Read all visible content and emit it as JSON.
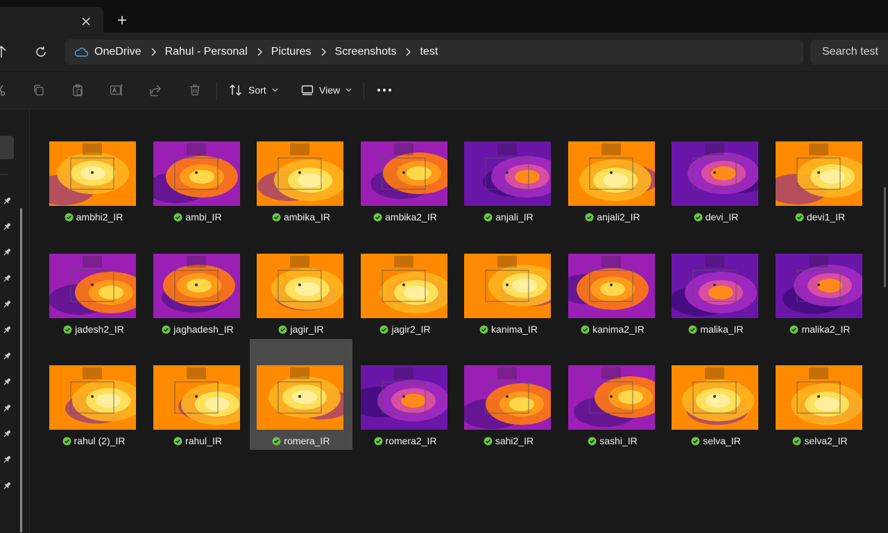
{
  "tab": {
    "close_glyph": "✕",
    "new_tab_glyph": "+"
  },
  "breadcrumb": [
    "OneDrive",
    "Rahul - Personal",
    "Pictures",
    "Screenshots",
    "test"
  ],
  "search": {
    "placeholder": "Search test"
  },
  "commands": {
    "sort_label": "Sort",
    "view_label": "View"
  },
  "colors": {
    "accent_sync": "#6cc24a",
    "thermal_hot": "#fff4a8",
    "thermal_warm": "#ff9a1a",
    "thermal_cool": "#7a1fa8"
  },
  "files": [
    {
      "name": "ambhi2_IR",
      "palette": "warm"
    },
    {
      "name": "ambi_IR",
      "palette": "mixed"
    },
    {
      "name": "ambika_IR",
      "palette": "warm"
    },
    {
      "name": "ambika2_IR",
      "palette": "mixed"
    },
    {
      "name": "anjali_IR",
      "palette": "cool"
    },
    {
      "name": "anjali2_IR",
      "palette": "warm"
    },
    {
      "name": "devi_IR",
      "palette": "cool"
    },
    {
      "name": "devi1_IR",
      "palette": "warm"
    },
    {
      "name": "jadesh2_IR",
      "palette": "mixed"
    },
    {
      "name": "jaghadesh_IR",
      "palette": "mixed"
    },
    {
      "name": "jagir_IR",
      "palette": "warm"
    },
    {
      "name": "jagir2_IR",
      "palette": "warm"
    },
    {
      "name": "kanima_IR",
      "palette": "warm"
    },
    {
      "name": "kanima2_IR",
      "palette": "mixed"
    },
    {
      "name": "malika_IR",
      "palette": "cool"
    },
    {
      "name": "malika2_IR",
      "palette": "cool"
    },
    {
      "name": "rahul (2)_IR",
      "palette": "warm"
    },
    {
      "name": "rahul_IR",
      "palette": "warm"
    },
    {
      "name": "romera_IR",
      "palette": "warm",
      "selected": true
    },
    {
      "name": "romera2_IR",
      "palette": "cool"
    },
    {
      "name": "sahi2_IR",
      "palette": "mixed"
    },
    {
      "name": "sashi_IR",
      "palette": "mixed"
    },
    {
      "name": "selva_IR",
      "palette": "warm"
    },
    {
      "name": "selva2_IR",
      "palette": "warm"
    }
  ]
}
